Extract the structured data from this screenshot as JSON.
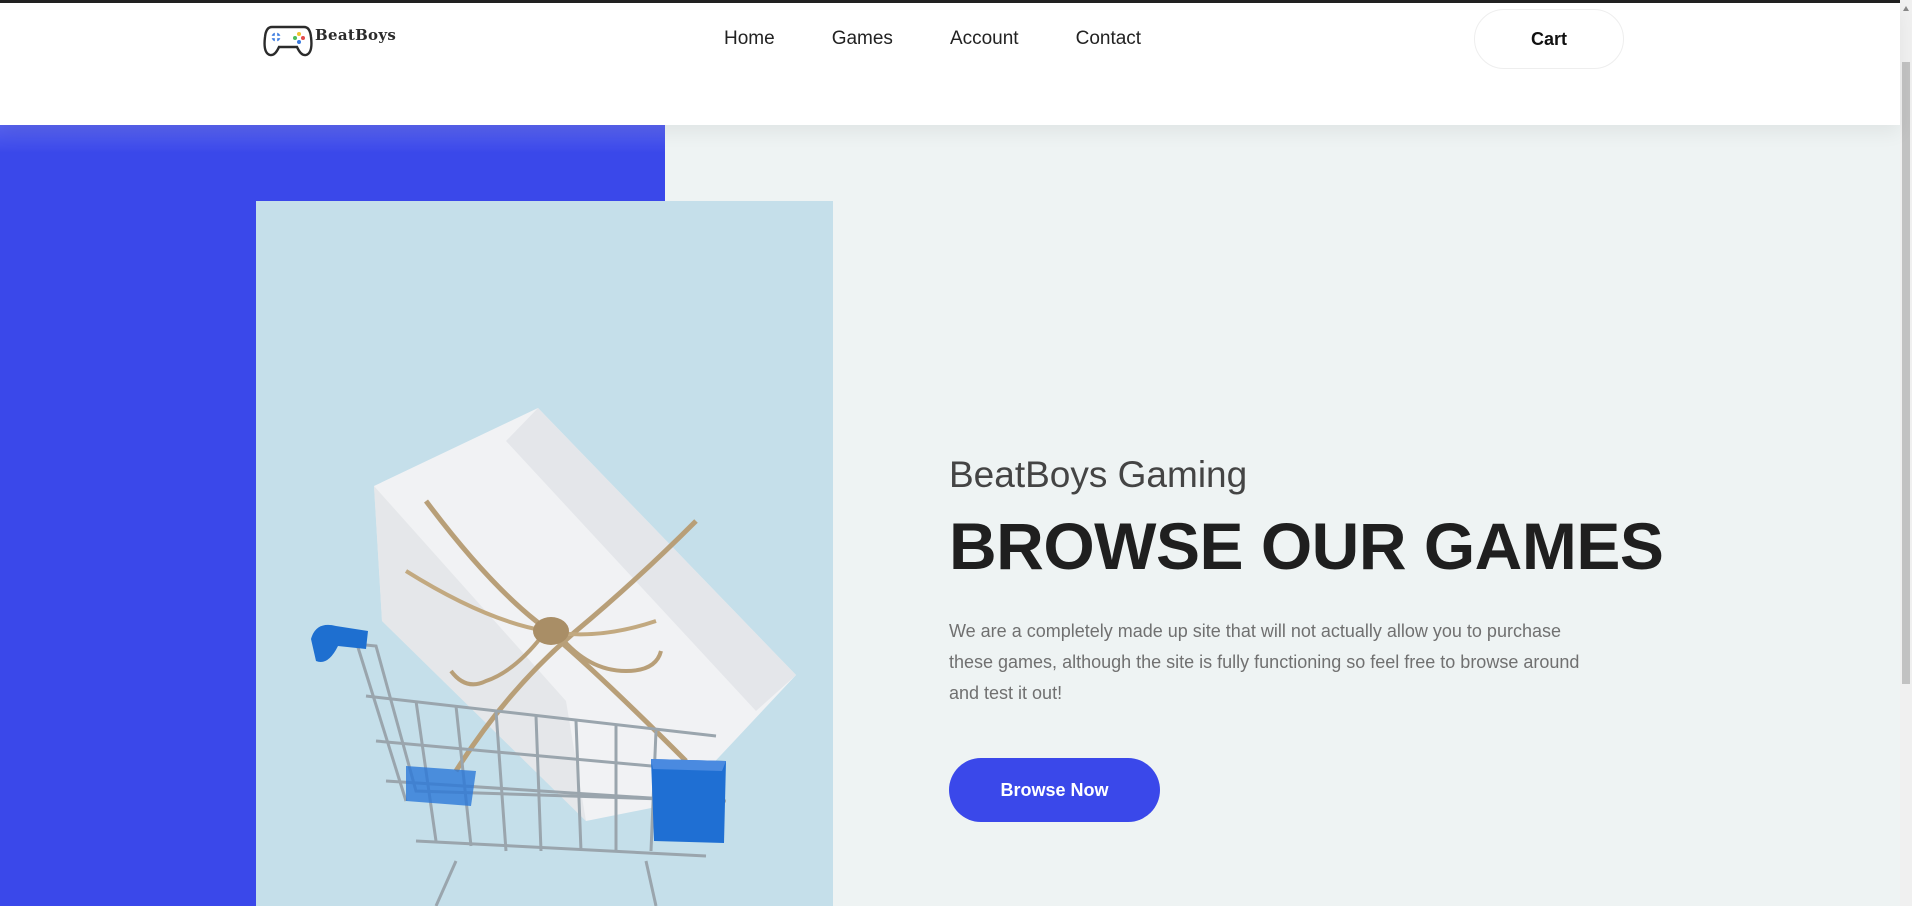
{
  "brand": {
    "name": "BeatBoys"
  },
  "nav": {
    "items": [
      {
        "label": "Home"
      },
      {
        "label": "Games"
      },
      {
        "label": "Account"
      },
      {
        "label": "Contact"
      }
    ],
    "cart_label": "Cart"
  },
  "hero": {
    "subtitle": "BeatBoys Gaming",
    "title": "BROWSE OUR GAMES",
    "description": "We are a completely made up site that will not actually allow you to purchase these games, although the site is fully functioning so feel free to browse around and test it out!",
    "button_label": "Browse Now",
    "image_icon": "gift-in-shopping-cart-image"
  },
  "colors": {
    "accent": "#3a48ea",
    "image_bg": "#c5dfea",
    "page_bg": "#eef3f3"
  }
}
